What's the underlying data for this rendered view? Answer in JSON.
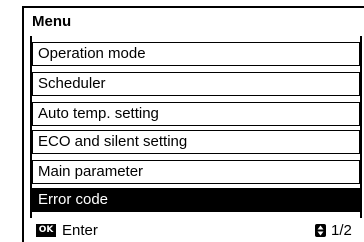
{
  "menu": {
    "title": "Menu",
    "items": [
      {
        "label": "Operation mode",
        "selected": false
      },
      {
        "label": "Scheduler",
        "selected": false
      },
      {
        "label": "Auto temp. setting",
        "selected": false
      },
      {
        "label": "ECO and silent setting",
        "selected": false
      },
      {
        "label": "Main parameter",
        "selected": false
      },
      {
        "label": "Error code",
        "selected": true
      }
    ]
  },
  "footer": {
    "ok_badge": "OK",
    "enter_label": "Enter",
    "page_icon": "up-down-arrows-icon",
    "page_indicator": "1/2"
  },
  "colors": {
    "background": "#ffffff",
    "foreground": "#000000",
    "selected_background": "#000000",
    "selected_text": "#ffffff"
  }
}
